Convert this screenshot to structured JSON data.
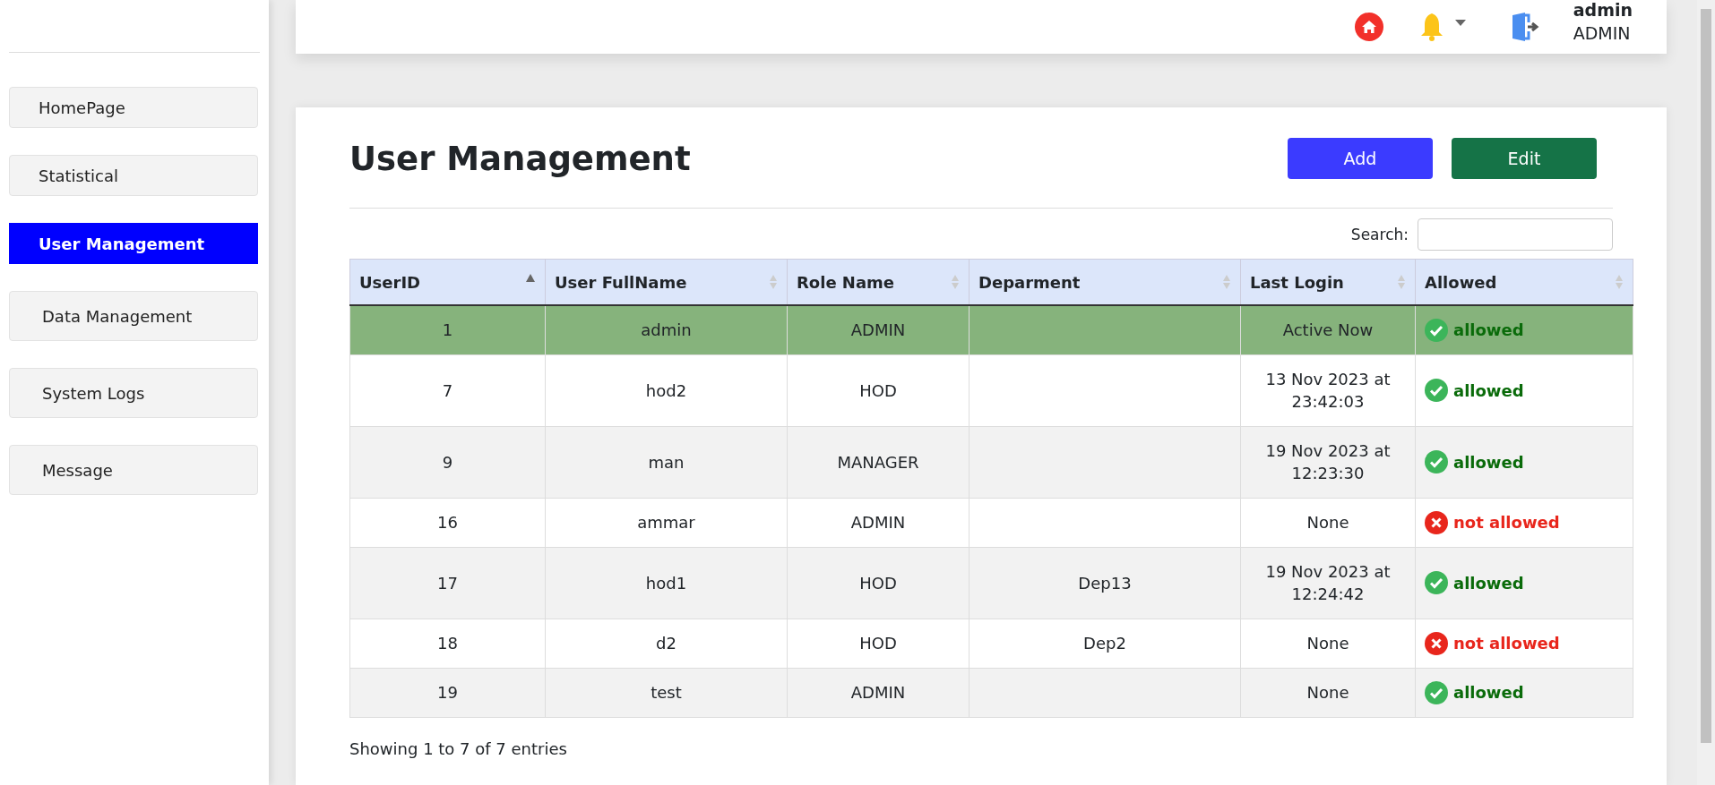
{
  "sidebar": {
    "items": [
      {
        "label": "HomePage",
        "selected": false
      },
      {
        "label": "Statistical",
        "selected": false
      },
      {
        "label": "User Management",
        "selected": true
      },
      {
        "label": "Data Management",
        "selected": false
      },
      {
        "label": "System Logs",
        "selected": false
      },
      {
        "label": "Message",
        "selected": false
      }
    ]
  },
  "topbar": {
    "user_name": "admin",
    "user_role": "ADMIN"
  },
  "page": {
    "title": "User Management",
    "buttons": [
      {
        "label": "Add",
        "kind": "primary"
      },
      {
        "label": "Edit",
        "kind": "success"
      }
    ],
    "search_label": "Search:"
  },
  "table": {
    "columns": [
      {
        "label": "UserID",
        "sorted": true
      },
      {
        "label": "User FullName",
        "sorted": false
      },
      {
        "label": "Role Name",
        "sorted": false
      },
      {
        "label": "Deparment",
        "sorted": false
      },
      {
        "label": "Last Login",
        "sorted": false
      },
      {
        "label": "Allowed",
        "sorted": false
      }
    ],
    "rows": [
      {
        "id": "1",
        "name": "admin",
        "role": "ADMIN",
        "last_login": "Active Now",
        "allowed": true,
        "status": "allowed",
        "selected": true
      },
      {
        "id": "7",
        "name": "hod2",
        "role": "HOD",
        "last_login": "13 Nov 2023 at 23:42:03",
        "allowed": true,
        "status": "allowed",
        "selected": false
      },
      {
        "id": "9",
        "name": "man",
        "role": "MANAGER",
        "last_login": "19 Nov 2023 at 12:23:30",
        "allowed": true,
        "status": "allowed",
        "selected": false
      },
      {
        "id": "16",
        "name": "ammar",
        "role": "ADMIN",
        "last_login": "None",
        "allowed": false,
        "status": "not allowed",
        "selected": false
      },
      {
        "id": "17",
        "name": "hod1",
        "role": "HOD",
        "department": "Dep13",
        "last_login": "19 Nov 2023 at 12:24:42",
        "allowed": true,
        "status": "allowed",
        "selected": false
      },
      {
        "id": "18",
        "name": "d2",
        "role": "HOD",
        "department": "Dep2",
        "last_login": "None",
        "allowed": false,
        "status": "not allowed",
        "selected": false
      },
      {
        "id": "19",
        "name": "test",
        "role": "ADMIN",
        "last_login": "None",
        "allowed": true,
        "status": "allowed",
        "selected": false
      }
    ]
  },
  "footer": {
    "info": "Showing 1 to 7 of 7 entries"
  }
}
